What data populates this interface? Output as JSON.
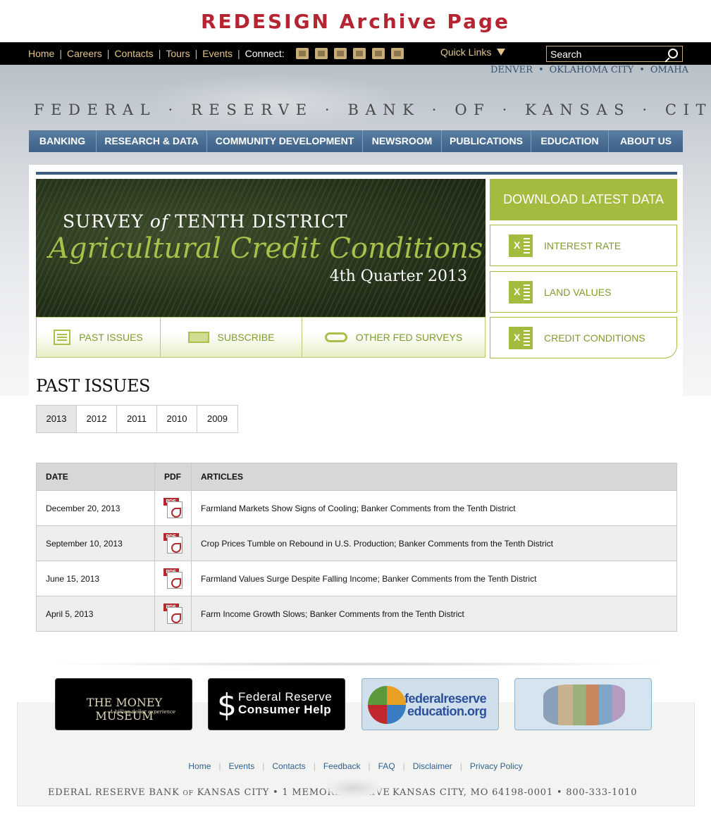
{
  "page_title": "REDESIGN Archive Page",
  "topnav": {
    "links": [
      "Home",
      "Careers",
      "Contacts",
      "Tours",
      "Events"
    ],
    "connect_label": "Connect:",
    "social_icons": [
      "email-icon",
      "rss-icon",
      "linkedin-icon",
      "pinterest-icon",
      "twitter-icon",
      "youtube-icon"
    ],
    "quick_links": "Quick Links",
    "search_placeholder": "Search"
  },
  "branches": [
    "DENVER",
    "OKLAHOMA CITY",
    "OMAHA"
  ],
  "bank_name": "FEDERAL · RESERVE · BANK · OF · KANSAS · CITY",
  "mainnav": [
    "BANKING",
    "RESEARCH & DATA",
    "COMMUNITY DEVELOPMENT",
    "NEWSROOM",
    "PUBLICATIONS",
    "EDUCATION",
    "ABOUT US"
  ],
  "banner": {
    "line1_a": "SURVEY",
    "line1_of": "of",
    "line1_b": "TENTH DISTRICT",
    "line2": "Agricultural Credit Conditions",
    "line3": "4th Quarter 2013"
  },
  "subbar": [
    "PAST ISSUES",
    "SUBSCRIBE",
    "OTHER FED SURVEYS"
  ],
  "downloads": {
    "header": "DOWNLOAD LATEST DATA",
    "items": [
      "INTEREST RATE",
      "LAND VALUES",
      "CREDIT CONDITIONS"
    ]
  },
  "past_issues": {
    "title": "PAST ISSUES",
    "years": [
      "2013",
      "2012",
      "2011",
      "2010",
      "2009"
    ],
    "active_year": "2013",
    "columns": [
      "DATE",
      "PDF",
      "ARTICLES"
    ],
    "pdf_badge": "PDF",
    "rows": [
      {
        "date": "December 20, 2013",
        "article": "Farmland Markets Show Signs of Cooling; Banker Comments from the Tenth District"
      },
      {
        "date": "September 10, 2013",
        "article": "Crop Prices Tumble on Rebound in U.S. Production; Banker Comments from the Tenth District"
      },
      {
        "date": "June 15, 2013",
        "article": "Farmland Values Surge Despite Falling Income; Banker Comments from the Tenth District"
      },
      {
        "date": "April 5, 2013",
        "article": "Farm Income Growth Slows; Banker Comments from the Tenth District"
      }
    ]
  },
  "partners": {
    "money_museum": {
      "title": "THE MONEY MUSEUM",
      "tagline": "A billion dollar experience"
    },
    "consumer_help": {
      "symbol": "$",
      "line1": "Federal Reserve",
      "line2": "Consumer Help"
    },
    "education": {
      "line1": "federalreserve",
      "line2": "education.org"
    }
  },
  "footer": {
    "links": [
      "Home",
      "Events",
      "Contacts",
      "Feedback",
      "FAQ",
      "Disclaimer",
      "Privacy Policy"
    ],
    "address_left": "EDERAL RESERVE BANK of KANSAS CITY • 1 MEMORIAL DRIVE",
    "address_right": "KANSAS CITY, MO 64198-0001 • 800-333-1010"
  }
}
